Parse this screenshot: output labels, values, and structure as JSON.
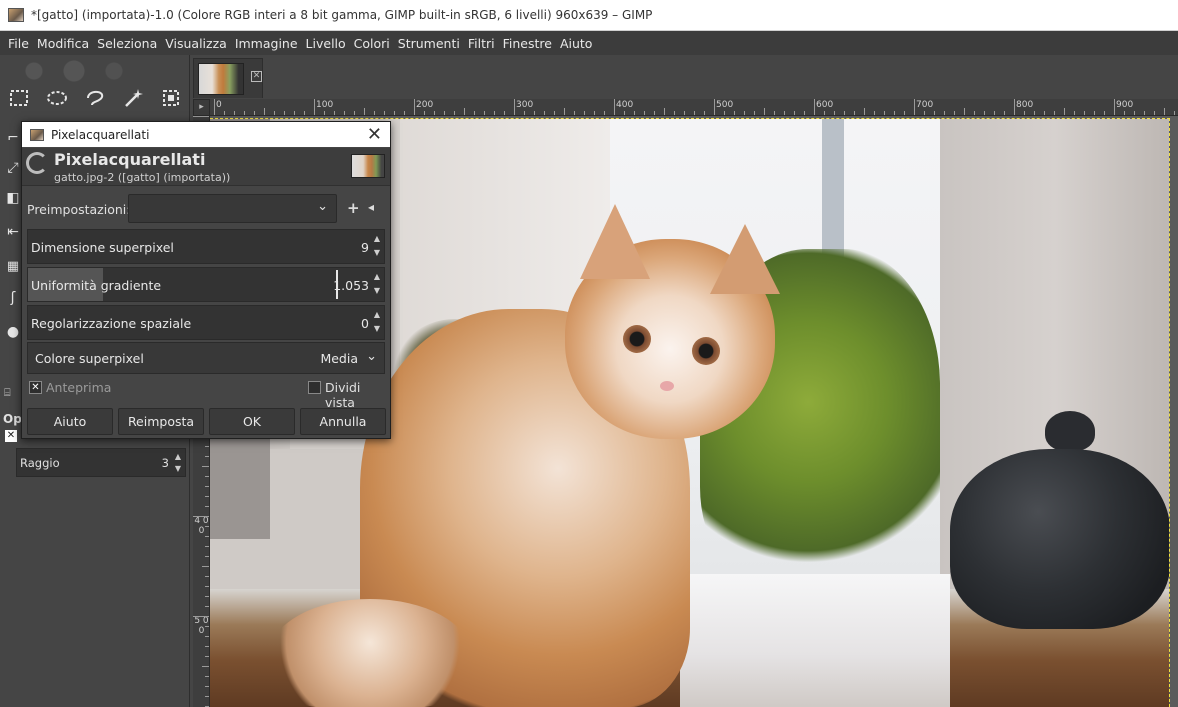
{
  "window": {
    "title": "*[gatto] (importata)-1.0 (Colore RGB interi a 8 bit gamma, GIMP built-in sRGB, 6 livelli) 960x639 – GIMP"
  },
  "menu": [
    "File",
    "Modifica",
    "Seleziona",
    "Visualizza",
    "Immagine",
    "Livello",
    "Colori",
    "Strumenti",
    "Filtri",
    "Finestre",
    "Aiuto"
  ],
  "toolbox": {
    "tools_row1": [
      "rect-select-icon",
      "ellipse-select-icon",
      "free-select-icon",
      "fuzzy-select-icon",
      "by-color-select-icon"
    ],
    "options_label": "Op",
    "radius": {
      "label": "Raggio",
      "value": "3"
    }
  },
  "image_tab": {
    "close_icon": "close-icon"
  },
  "rulers": {
    "top": [
      "0",
      "100",
      "200",
      "300",
      "400",
      "500",
      "600",
      "700",
      "800",
      "900"
    ],
    "left": [
      "4 0 0",
      "5 0 0"
    ]
  },
  "dialog": {
    "window_title": "Pixelacquarellati",
    "header_title": "Pixelacquarellati",
    "header_subtitle": "gatto.jpg-2 ([gatto] (importata))",
    "presets_label": "Preimpostazioni:",
    "presets_value": "",
    "superpixel_size": {
      "label": "Dimensione superpixel",
      "value": "9"
    },
    "gradient_smoothness": {
      "label": "Uniformità gradiente",
      "value": "1.053",
      "fill_fraction": 0.21
    },
    "spatial_regularization": {
      "label": "Regolarizzazione spaziale",
      "value": "0"
    },
    "superpixel_color": {
      "label": "Colore superpixel",
      "value": "Media"
    },
    "preview": {
      "label": "Anteprima",
      "checked": true
    },
    "split_view": {
      "label": "Dividi vista",
      "checked": false
    },
    "buttons": {
      "help": "Aiuto",
      "reset": "Reimposta",
      "ok": "OK",
      "cancel": "Annulla"
    }
  },
  "colors": {
    "bg": "#454545",
    "menubar": "#3c3c3c",
    "field": "#333333",
    "selection_border": "#f0e040"
  }
}
